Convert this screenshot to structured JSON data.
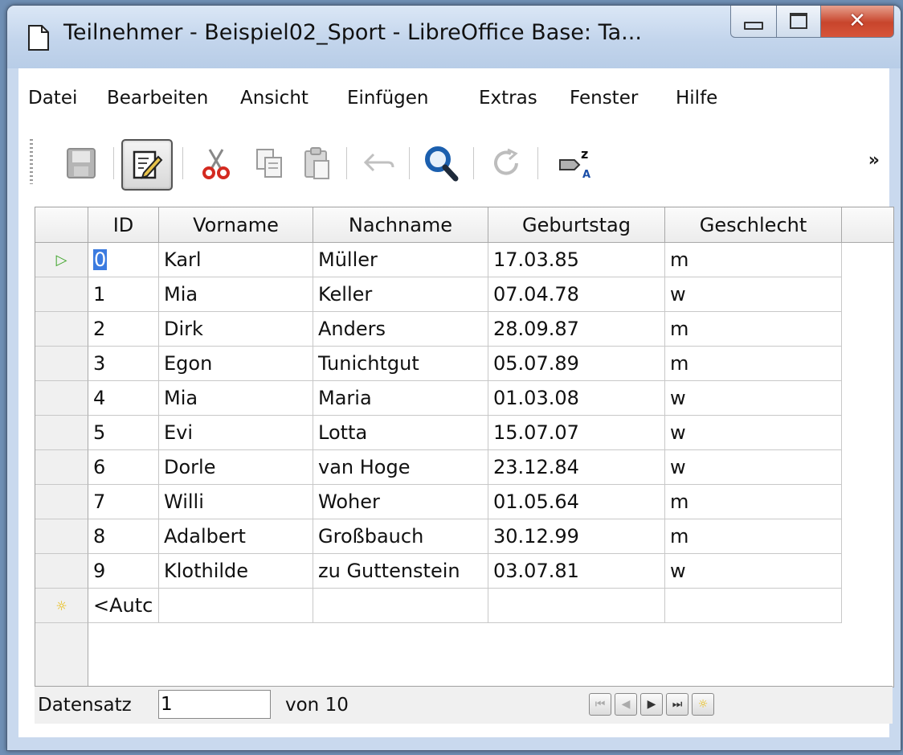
{
  "window": {
    "title": "Teilnehmer - Beispiel02_Sport - LibreOffice Base: Ta..."
  },
  "menu": [
    {
      "label": "Datei"
    },
    {
      "label": "Bearbeiten"
    },
    {
      "label": "Ansicht"
    },
    {
      "label": "Einfügen"
    },
    {
      "label": "Extras"
    },
    {
      "label": "Fenster"
    },
    {
      "label": "Hilfe"
    }
  ],
  "toolbar": {
    "overflow_label": "»",
    "buttons": [
      "save-icon",
      "edit-icon",
      "cut-icon",
      "copy-icon",
      "paste-icon",
      "undo-icon",
      "find-icon",
      "refresh-icon",
      "sort-icon"
    ]
  },
  "table": {
    "columns": [
      "ID",
      "Vorname",
      "Nachname",
      "Geburtstag",
      "Geschlecht"
    ],
    "rows": [
      [
        "0",
        "Karl",
        "Müller",
        "17.03.85",
        "m"
      ],
      [
        "1",
        "Mia",
        "Keller",
        "07.04.78",
        "w"
      ],
      [
        "2",
        "Dirk",
        "Anders",
        "28.09.87",
        "m"
      ],
      [
        "3",
        "Egon",
        "Tunichtgut",
        "05.07.89",
        "m"
      ],
      [
        "4",
        "Mia",
        "Maria",
        "01.03.08",
        "w"
      ],
      [
        "5",
        "Evi",
        "Lotta",
        "15.07.07",
        "w"
      ],
      [
        "6",
        "Dorle",
        "van Hoge",
        "23.12.84",
        "w"
      ],
      [
        "7",
        "Willi",
        "Woher",
        "01.05.64",
        "m"
      ],
      [
        "8",
        "Adalbert",
        "Großbauch",
        "30.12.99",
        "m"
      ],
      [
        "9",
        "Klothilde",
        "zu Guttenstein",
        "03.07.81",
        "w"
      ]
    ],
    "new_row_placeholder": "<Autc",
    "current_row_indicator": "▷",
    "new_row_indicator": "☼"
  },
  "navigation": {
    "record_label": "Datensatz",
    "record_value": "1",
    "of_label": "von 10"
  },
  "colors": {
    "selection": "#3b7be0",
    "current_marker": "#3fa52a",
    "new_marker": "#e8b800"
  }
}
